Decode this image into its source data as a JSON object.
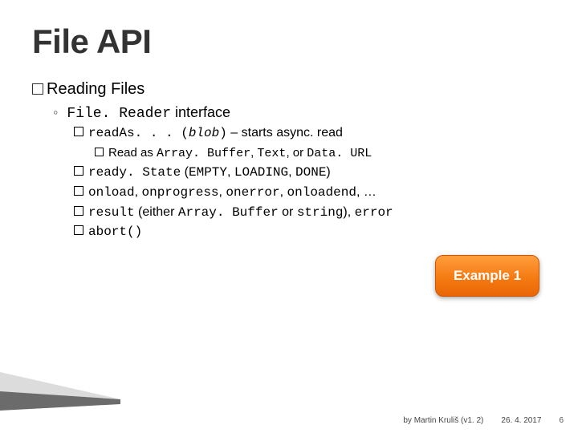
{
  "title": "File API",
  "section": {
    "prefix_word": "Reading",
    "suffix_word": " Files"
  },
  "interface_line": {
    "diamond": "◦",
    "code": "File. Reader",
    "suffix": " interface"
  },
  "bullets": [
    {
      "parts": [
        {
          "t": "readAs. . . (",
          "mono": true
        },
        {
          "t": "blob",
          "mono": true,
          "it": true
        },
        {
          "t": ")",
          "mono": true
        },
        {
          "t": " – starts async. read"
        }
      ],
      "inner": [
        {
          "parts": [
            {
              "t": "Read as "
            },
            {
              "t": "Array. Buffer",
              "mono": true
            },
            {
              "t": ", "
            },
            {
              "t": "Text",
              "mono": true
            },
            {
              "t": ", or "
            },
            {
              "t": "Data. URL",
              "mono": true
            }
          ]
        }
      ]
    },
    {
      "parts": [
        {
          "t": "ready. State",
          "mono": true
        },
        {
          "t": " ("
        },
        {
          "t": "EMPTY",
          "mono": true
        },
        {
          "t": ", "
        },
        {
          "t": "LOADING",
          "mono": true
        },
        {
          "t": ", "
        },
        {
          "t": "DONE",
          "mono": true
        },
        {
          "t": ")"
        }
      ]
    },
    {
      "parts": [
        {
          "t": "onload",
          "mono": true
        },
        {
          "t": ", "
        },
        {
          "t": "onprogress",
          "mono": true
        },
        {
          "t": ", "
        },
        {
          "t": "onerror",
          "mono": true
        },
        {
          "t": ", "
        },
        {
          "t": "onloadend",
          "mono": true
        },
        {
          "t": ", …"
        }
      ]
    },
    {
      "parts": [
        {
          "t": "result",
          "mono": true
        },
        {
          "t": " (either "
        },
        {
          "t": "Array. Buffer",
          "mono": true
        },
        {
          "t": " or "
        },
        {
          "t": "string",
          "mono": true
        },
        {
          "t": "), "
        },
        {
          "t": "error",
          "mono": true
        }
      ]
    },
    {
      "parts": [
        {
          "t": "abort()",
          "mono": true
        }
      ]
    }
  ],
  "badge": "Example 1",
  "footer": {
    "author": "by Martin Kruliš (v1. 2)",
    "date": "26. 4. 2017",
    "page": "6"
  },
  "wedge_colors": {
    "top": "#dcdcdc",
    "bottom": "#6b6b6b"
  }
}
